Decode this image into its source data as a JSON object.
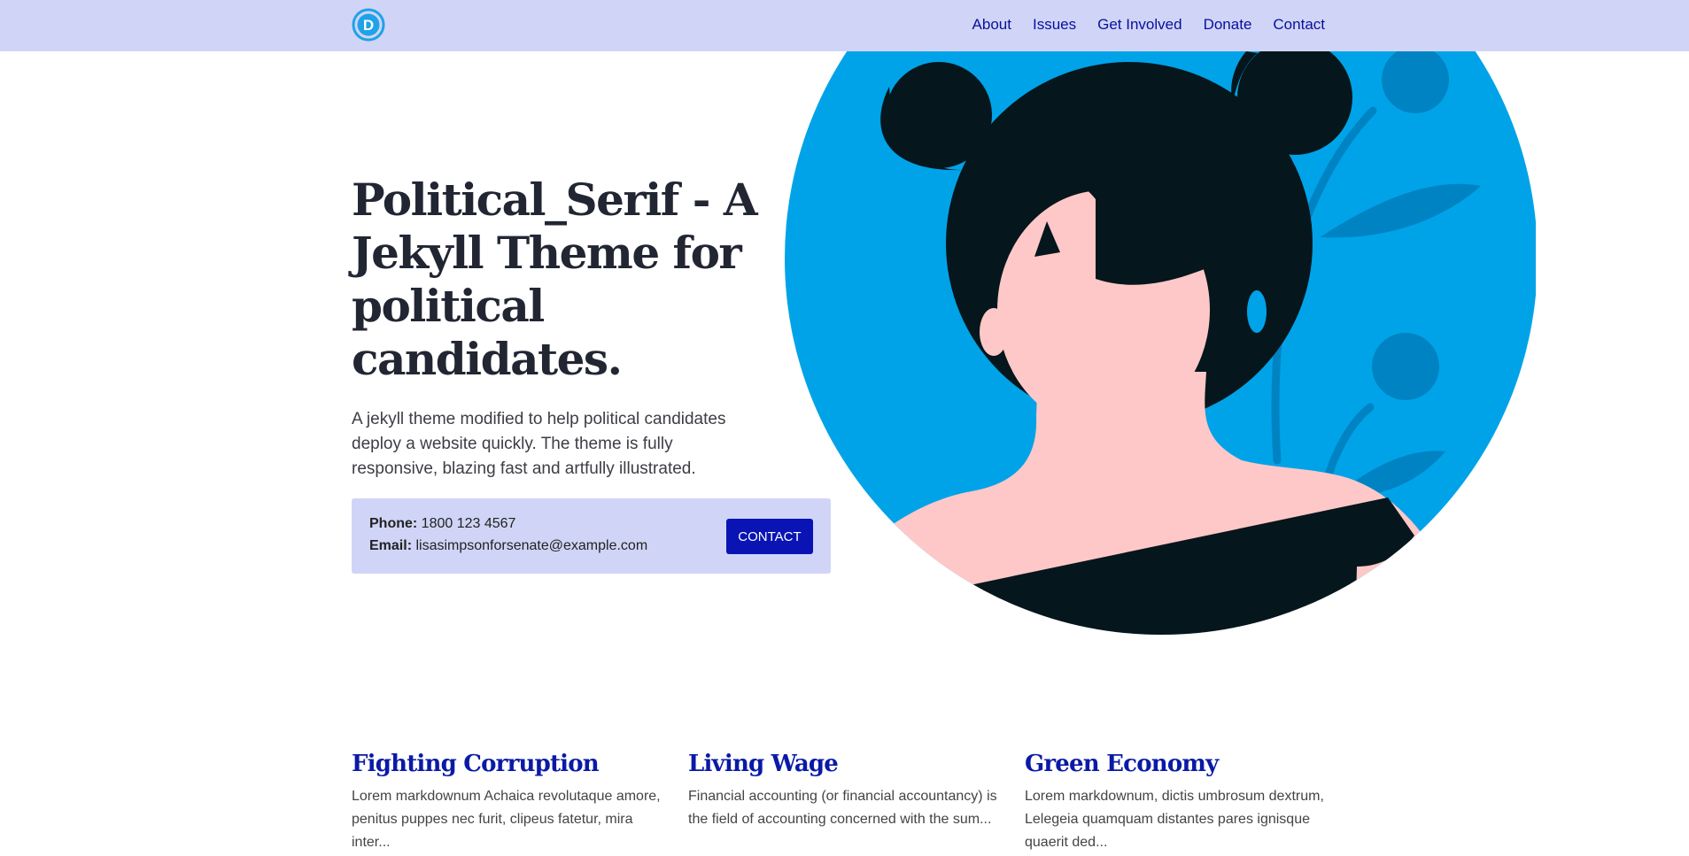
{
  "nav": {
    "logo_letter": "D",
    "links": [
      "About",
      "Issues",
      "Get Involved",
      "Donate",
      "Contact"
    ]
  },
  "hero": {
    "title": "Political_Serif - A Jekyll Theme for political candidates.",
    "description": "A jekyll theme modified to help political candidates deploy a website quickly. The theme is fully responsive, blazing fast and artfully illustrated."
  },
  "contact": {
    "phone_label": "Phone:",
    "phone": "1800 123 4567",
    "email_label": "Email:",
    "email": "lisasimpsonforsenate@example.com",
    "button_label": "CONTACT"
  },
  "issues": [
    {
      "title": "Fighting Corruption",
      "text": "Lorem markdownum Achaica revolutaque amore, penitus puppes nec furit, clipeus fatetur, mira inter..."
    },
    {
      "title": "Living Wage",
      "text": "Financial accounting (or financial accountancy) is the field of accounting concerned with the sum..."
    },
    {
      "title": "Green Economy",
      "text": "Lorem markdownum, dictis umbrosum dextrum, Lelegeia quamquam distantes pares ignisque quaerit ded..."
    }
  ],
  "colors": {
    "navbar_bg": "#d0d5f7",
    "accent_blue": "#0a14b4",
    "illustration_sky": "#00a3e8",
    "hair": "#05161c",
    "skin": "#ffc8c8"
  }
}
